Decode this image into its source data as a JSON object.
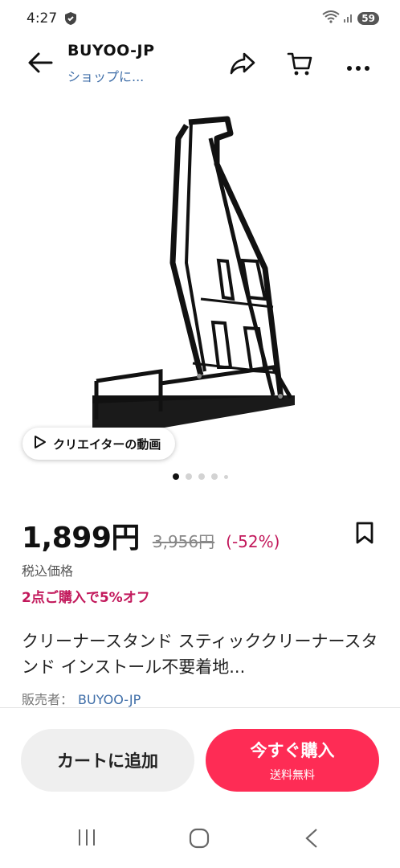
{
  "status": {
    "time": "4:27",
    "battery": "59"
  },
  "header": {
    "shop_name": "BUYOO-JP",
    "shop_link": "ショップに..."
  },
  "gallery": {
    "creator_video_label": "クリエイターの動画",
    "dot_count": 5,
    "active_index": 0
  },
  "product": {
    "price": "1,899円",
    "original_price": "3,956円",
    "discount": "(-52%)",
    "tax_note": "税込価格",
    "promo": "2点ご購入で5%オフ",
    "title": "クリーナースタンド スティッククリーナースタンド インストール不要着地...",
    "seller_label": "販売者：",
    "seller_name": "BUYOO-JP"
  },
  "actions": {
    "add_to_cart": "カートに追加",
    "buy_now": "今すぐ購入",
    "buy_now_sub": "送料無料"
  },
  "icons": [
    "back-arrow-icon",
    "share-icon",
    "cart-icon",
    "more-icon",
    "play-icon",
    "bookmark-icon",
    "recent-apps-icon",
    "home-icon",
    "nav-back-icon",
    "shield-icon",
    "wifi-icon",
    "signal-icon"
  ],
  "colors": {
    "accent": "#fe2c55",
    "discount": "#c2185b",
    "link": "#3f6ea8"
  }
}
